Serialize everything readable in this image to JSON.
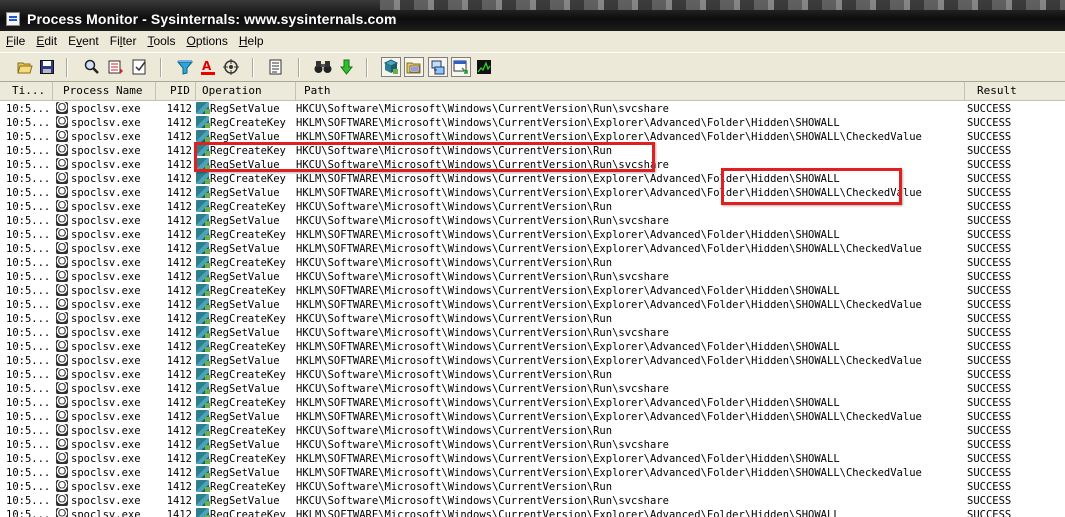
{
  "window": {
    "title": "Process Monitor - Sysinternals: www.sysinternals.com"
  },
  "menu": [
    {
      "pre": "",
      "ul": "F",
      "post": "ile"
    },
    {
      "pre": "",
      "ul": "E",
      "post": "dit"
    },
    {
      "pre": "E",
      "ul": "v",
      "post": "ent"
    },
    {
      "pre": "Fi",
      "ul": "l",
      "post": "ter"
    },
    {
      "pre": "",
      "ul": "T",
      "post": "ools"
    },
    {
      "pre": "",
      "ul": "O",
      "post": "ptions"
    },
    {
      "pre": "",
      "ul": "H",
      "post": "elp"
    }
  ],
  "toolbar": {
    "buttons": [
      {
        "name": "open-icon"
      },
      {
        "name": "save-icon"
      },
      {
        "name": "find-icon"
      },
      {
        "name": "autoscroll-icon"
      },
      {
        "name": "clear-icon"
      },
      {
        "name": "filter-icon"
      },
      {
        "name": "highlight-icon"
      },
      {
        "name": "target-icon"
      },
      {
        "name": "event-properties-icon"
      },
      {
        "name": "binoculars-icon"
      },
      {
        "name": "jump-icon"
      },
      {
        "name": "show-registry-icon",
        "pressed": true
      },
      {
        "name": "show-filesystem-icon",
        "pressed": true
      },
      {
        "name": "show-network-icon",
        "pressed": true
      },
      {
        "name": "show-process-icon",
        "pressed": true
      },
      {
        "name": "show-profiling-icon"
      }
    ]
  },
  "columns": {
    "time": "Ti...",
    "process": "Process Name",
    "pid": "PID",
    "operation": "Operation",
    "path": "Path",
    "result": "Result"
  },
  "rows": [
    {
      "time": "10:5...",
      "process": "spoclsv.exe",
      "pid": "1412",
      "op": "RegSetValue",
      "path": "HKCU\\Software\\Microsoft\\Windows\\CurrentVersion\\Run\\svcshare",
      "result": "SUCCESS"
    },
    {
      "time": "10:5...",
      "process": "spoclsv.exe",
      "pid": "1412",
      "op": "RegCreateKey",
      "path": "HKLM\\SOFTWARE\\Microsoft\\Windows\\CurrentVersion\\Explorer\\Advanced\\Folder\\Hidden\\SHOWALL",
      "result": "SUCCESS"
    },
    {
      "time": "10:5...",
      "process": "spoclsv.exe",
      "pid": "1412",
      "op": "RegSetValue",
      "path": "HKLM\\SOFTWARE\\Microsoft\\Windows\\CurrentVersion\\Explorer\\Advanced\\Folder\\Hidden\\SHOWALL\\CheckedValue",
      "result": "SUCCESS"
    },
    {
      "time": "10:5...",
      "process": "spoclsv.exe",
      "pid": "1412",
      "op": "RegCreateKey",
      "path": "HKCU\\Software\\Microsoft\\Windows\\CurrentVersion\\Run",
      "result": "SUCCESS"
    },
    {
      "time": "10:5...",
      "process": "spoclsv.exe",
      "pid": "1412",
      "op": "RegSetValue",
      "path": "HKCU\\Software\\Microsoft\\Windows\\CurrentVersion\\Run\\svcshare",
      "result": "SUCCESS"
    },
    {
      "time": "10:5...",
      "process": "spoclsv.exe",
      "pid": "1412",
      "op": "RegCreateKey",
      "path": "HKLM\\SOFTWARE\\Microsoft\\Windows\\CurrentVersion\\Explorer\\Advanced\\Folder\\Hidden\\SHOWALL",
      "result": "SUCCESS"
    },
    {
      "time": "10:5...",
      "process": "spoclsv.exe",
      "pid": "1412",
      "op": "RegSetValue",
      "path": "HKLM\\SOFTWARE\\Microsoft\\Windows\\CurrentVersion\\Explorer\\Advanced\\Folder\\Hidden\\SHOWALL\\CheckedValue",
      "result": "SUCCESS"
    },
    {
      "time": "10:5...",
      "process": "spoclsv.exe",
      "pid": "1412",
      "op": "RegCreateKey",
      "path": "HKCU\\Software\\Microsoft\\Windows\\CurrentVersion\\Run",
      "result": "SUCCESS"
    },
    {
      "time": "10:5...",
      "process": "spoclsv.exe",
      "pid": "1412",
      "op": "RegSetValue",
      "path": "HKCU\\Software\\Microsoft\\Windows\\CurrentVersion\\Run\\svcshare",
      "result": "SUCCESS"
    },
    {
      "time": "10:5...",
      "process": "spoclsv.exe",
      "pid": "1412",
      "op": "RegCreateKey",
      "path": "HKLM\\SOFTWARE\\Microsoft\\Windows\\CurrentVersion\\Explorer\\Advanced\\Folder\\Hidden\\SHOWALL",
      "result": "SUCCESS"
    },
    {
      "time": "10:5...",
      "process": "spoclsv.exe",
      "pid": "1412",
      "op": "RegSetValue",
      "path": "HKLM\\SOFTWARE\\Microsoft\\Windows\\CurrentVersion\\Explorer\\Advanced\\Folder\\Hidden\\SHOWALL\\CheckedValue",
      "result": "SUCCESS"
    },
    {
      "time": "10:5...",
      "process": "spoclsv.exe",
      "pid": "1412",
      "op": "RegCreateKey",
      "path": "HKCU\\Software\\Microsoft\\Windows\\CurrentVersion\\Run",
      "result": "SUCCESS"
    },
    {
      "time": "10:5...",
      "process": "spoclsv.exe",
      "pid": "1412",
      "op": "RegSetValue",
      "path": "HKCU\\Software\\Microsoft\\Windows\\CurrentVersion\\Run\\svcshare",
      "result": "SUCCESS"
    },
    {
      "time": "10:5...",
      "process": "spoclsv.exe",
      "pid": "1412",
      "op": "RegCreateKey",
      "path": "HKLM\\SOFTWARE\\Microsoft\\Windows\\CurrentVersion\\Explorer\\Advanced\\Folder\\Hidden\\SHOWALL",
      "result": "SUCCESS"
    },
    {
      "time": "10:5...",
      "process": "spoclsv.exe",
      "pid": "1412",
      "op": "RegSetValue",
      "path": "HKLM\\SOFTWARE\\Microsoft\\Windows\\CurrentVersion\\Explorer\\Advanced\\Folder\\Hidden\\SHOWALL\\CheckedValue",
      "result": "SUCCESS"
    },
    {
      "time": "10:5...",
      "process": "spoclsv.exe",
      "pid": "1412",
      "op": "RegCreateKey",
      "path": "HKCU\\Software\\Microsoft\\Windows\\CurrentVersion\\Run",
      "result": "SUCCESS"
    },
    {
      "time": "10:5...",
      "process": "spoclsv.exe",
      "pid": "1412",
      "op": "RegSetValue",
      "path": "HKCU\\Software\\Microsoft\\Windows\\CurrentVersion\\Run\\svcshare",
      "result": "SUCCESS"
    },
    {
      "time": "10:5...",
      "process": "spoclsv.exe",
      "pid": "1412",
      "op": "RegCreateKey",
      "path": "HKLM\\SOFTWARE\\Microsoft\\Windows\\CurrentVersion\\Explorer\\Advanced\\Folder\\Hidden\\SHOWALL",
      "result": "SUCCESS"
    },
    {
      "time": "10:5...",
      "process": "spoclsv.exe",
      "pid": "1412",
      "op": "RegSetValue",
      "path": "HKLM\\SOFTWARE\\Microsoft\\Windows\\CurrentVersion\\Explorer\\Advanced\\Folder\\Hidden\\SHOWALL\\CheckedValue",
      "result": "SUCCESS"
    },
    {
      "time": "10:5...",
      "process": "spoclsv.exe",
      "pid": "1412",
      "op": "RegCreateKey",
      "path": "HKCU\\Software\\Microsoft\\Windows\\CurrentVersion\\Run",
      "result": "SUCCESS"
    },
    {
      "time": "10:5...",
      "process": "spoclsv.exe",
      "pid": "1412",
      "op": "RegSetValue",
      "path": "HKCU\\Software\\Microsoft\\Windows\\CurrentVersion\\Run\\svcshare",
      "result": "SUCCESS"
    },
    {
      "time": "10:5...",
      "process": "spoclsv.exe",
      "pid": "1412",
      "op": "RegCreateKey",
      "path": "HKLM\\SOFTWARE\\Microsoft\\Windows\\CurrentVersion\\Explorer\\Advanced\\Folder\\Hidden\\SHOWALL",
      "result": "SUCCESS"
    },
    {
      "time": "10:5...",
      "process": "spoclsv.exe",
      "pid": "1412",
      "op": "RegSetValue",
      "path": "HKLM\\SOFTWARE\\Microsoft\\Windows\\CurrentVersion\\Explorer\\Advanced\\Folder\\Hidden\\SHOWALL\\CheckedValue",
      "result": "SUCCESS"
    },
    {
      "time": "10:5...",
      "process": "spoclsv.exe",
      "pid": "1412",
      "op": "RegCreateKey",
      "path": "HKCU\\Software\\Microsoft\\Windows\\CurrentVersion\\Run",
      "result": "SUCCESS"
    },
    {
      "time": "10:5...",
      "process": "spoclsv.exe",
      "pid": "1412",
      "op": "RegSetValue",
      "path": "HKCU\\Software\\Microsoft\\Windows\\CurrentVersion\\Run\\svcshare",
      "result": "SUCCESS"
    },
    {
      "time": "10:5...",
      "process": "spoclsv.exe",
      "pid": "1412",
      "op": "RegCreateKey",
      "path": "HKLM\\SOFTWARE\\Microsoft\\Windows\\CurrentVersion\\Explorer\\Advanced\\Folder\\Hidden\\SHOWALL",
      "result": "SUCCESS"
    },
    {
      "time": "10:5...",
      "process": "spoclsv.exe",
      "pid": "1412",
      "op": "RegSetValue",
      "path": "HKLM\\SOFTWARE\\Microsoft\\Windows\\CurrentVersion\\Explorer\\Advanced\\Folder\\Hidden\\SHOWALL\\CheckedValue",
      "result": "SUCCESS"
    },
    {
      "time": "10:5...",
      "process": "spoclsv.exe",
      "pid": "1412",
      "op": "RegCreateKey",
      "path": "HKCU\\Software\\Microsoft\\Windows\\CurrentVersion\\Run",
      "result": "SUCCESS"
    },
    {
      "time": "10:5...",
      "process": "spoclsv.exe",
      "pid": "1412",
      "op": "RegSetValue",
      "path": "HKCU\\Software\\Microsoft\\Windows\\CurrentVersion\\Run\\svcshare",
      "result": "SUCCESS"
    },
    {
      "time": "10:5...",
      "process": "spoclsv.exe",
      "pid": "1412",
      "op": "RegCreateKey",
      "path": "HKLM\\SOFTWARE\\Microsoft\\Windows\\CurrentVersion\\Explorer\\Advanced\\Folder\\Hidden\\SHOWALL",
      "result": "SUCCESS"
    }
  ],
  "colors": {
    "highlight": "#e02020",
    "toolbar": "#ece9d8",
    "title": "#111111"
  }
}
